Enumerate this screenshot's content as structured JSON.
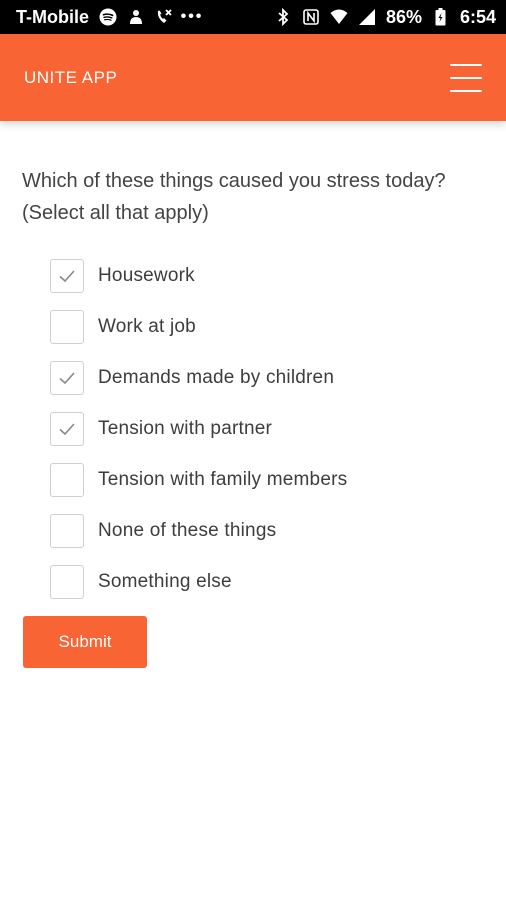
{
  "status_bar": {
    "carrier": "T-Mobile",
    "left_icons": [
      "spotify-icon",
      "app-notification-icon",
      "missed-call-icon",
      "more-dots-icon"
    ],
    "right_icons": [
      "bluetooth-icon",
      "nfc-icon",
      "wifi-icon",
      "signal-icon",
      "battery-icon"
    ],
    "battery": "86%",
    "time": "6:54"
  },
  "app_bar": {
    "title": "UNITE APP",
    "menu_icon": "hamburger-menu-icon"
  },
  "question": "Which of these things caused you stress today? (Select all that apply)",
  "options": [
    {
      "label": "Housework",
      "checked": true
    },
    {
      "label": "Work at job",
      "checked": false
    },
    {
      "label": "Demands made by children",
      "checked": true
    },
    {
      "label": "Tension with partner",
      "checked": true
    },
    {
      "label": "Tension with family members",
      "checked": false
    },
    {
      "label": "None of these things",
      "checked": false
    },
    {
      "label": "Something else",
      "checked": false
    }
  ],
  "submit_label": "Submit",
  "colors": {
    "accent": "#f86433",
    "status_bar": "#000000",
    "text": "#444444",
    "check": "#888888"
  }
}
